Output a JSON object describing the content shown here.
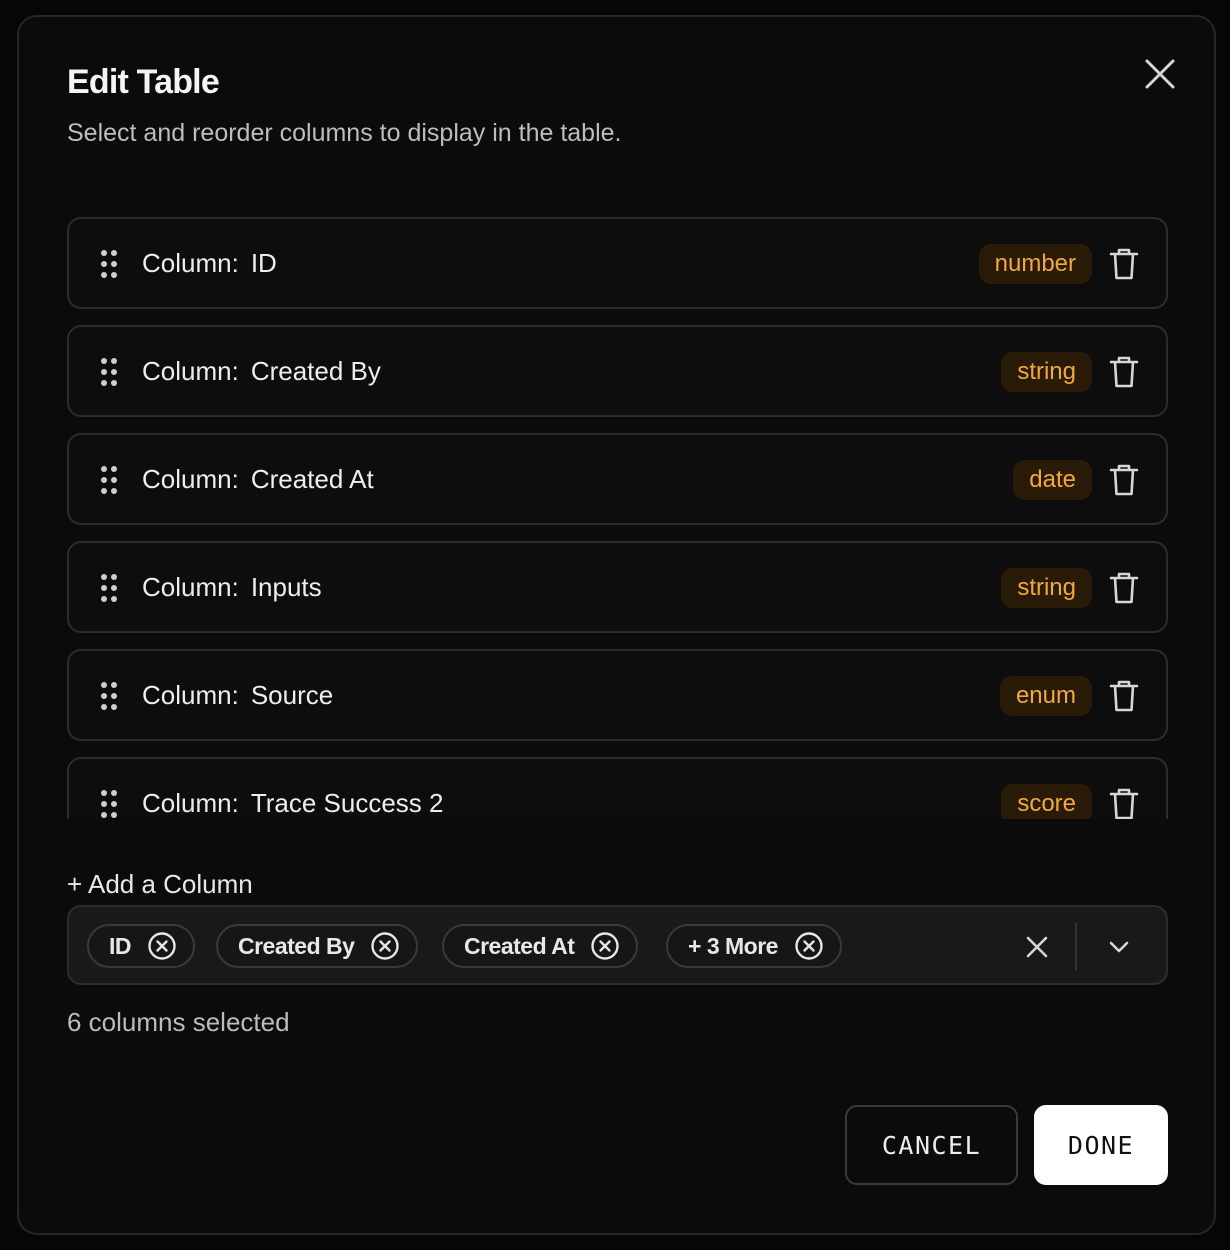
{
  "dialog": {
    "title": "Edit Table",
    "subtitle": "Select and reorder columns to display in the table."
  },
  "columns": {
    "prefix": "Column:",
    "items": [
      {
        "name": "ID",
        "type": "number"
      },
      {
        "name": "Created By",
        "type": "string"
      },
      {
        "name": "Created At",
        "type": "date"
      },
      {
        "name": "Inputs",
        "type": "string"
      },
      {
        "name": "Source",
        "type": "enum"
      },
      {
        "name": "Trace Success 2",
        "type": "score"
      }
    ]
  },
  "add_column_label": "+ Add a Column",
  "selector": {
    "chips": [
      "ID",
      "Created By",
      "Created At",
      "+ 3 More"
    ]
  },
  "selected_count": "6 columns selected",
  "actions": {
    "cancel_label": "CANCEL",
    "done_label": "DONE"
  },
  "colors": {
    "badge_text": "#f2a93b",
    "badge_bg": "#2a1a08",
    "modal_bg": "#0b0b0b",
    "primary_button_bg": "#ffffff"
  },
  "icons": {
    "close": "close-icon",
    "drag": "drag-handle-icon",
    "delete": "trash-icon",
    "chip_remove": "circle-x-icon",
    "clear": "clear-icon",
    "dropdown": "chevron-down-icon"
  }
}
